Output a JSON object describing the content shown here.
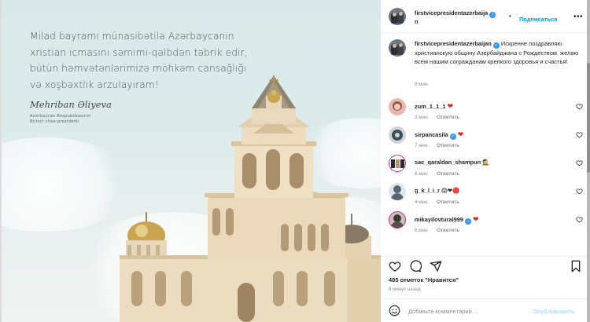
{
  "post_image": {
    "greeting_lines": [
      "Milad bayramı münasibətilə Azərbaycanın",
      "xristian icmasını səmimi-qəlbdən təbrik edir,",
      "bütün həmvətənlərimizə möhkəm cansağlığı",
      "və xoşbəxtlik arzulayıram!"
    ],
    "signer_name": "Mehriban Əliyeva",
    "signer_title_line1": "Azərbaycan Respublikasının",
    "signer_title_line2": "Birinci vitse-prezidenti"
  },
  "header": {
    "username_line1": "firstvicepresidentazerbaija",
    "username_line2": "n",
    "verified_icon": "verified-badge-icon",
    "separator": "•",
    "follow_label": "Подписаться",
    "more_icon": "more-options-icon",
    "more_glyph": "•••"
  },
  "caption": {
    "username": "firstvicepresidentazerbaijan",
    "text": "Искренне поздравляю христианскую общину Азербайджана с Рождеством. желаю всем нашим согражданам крепкого здоровья и счастья!",
    "time": "8 мин."
  },
  "comments": [
    {
      "username": "zum_1_1_1",
      "emoji": "❤",
      "time": "3 мин.",
      "reply_label": "Ответить",
      "verified": false
    },
    {
      "username": "sirpancasila",
      "emoji": "❤",
      "time": "7 мин.",
      "reply_label": "Ответить",
      "verified": true
    },
    {
      "username": "sac_qaraldan_shampun",
      "emoji": "🕵",
      "time": "6 мин.",
      "reply_label": "Ответить",
      "verified": false
    },
    {
      "username": "g_k_l_i_r",
      "emoji": "😱❤🔴",
      "time": "4 мин.",
      "reply_label": "Ответить",
      "verified": false
    },
    {
      "username": "mikayilovtural999",
      "emoji": "❤",
      "time": "6 мин.",
      "reply_label": "Ответить",
      "verified": true
    }
  ],
  "actions": {
    "like_icon": "heart-icon",
    "comment_icon": "comment-icon",
    "share_icon": "share-icon",
    "save_icon": "bookmark-icon"
  },
  "likes_text": "485 отметок \"Нравится\"",
  "time_ago": "8 минут назад",
  "composer": {
    "emoji_icon": "smile-icon",
    "placeholder": "Добавьте комментарий...",
    "post_label": "Опубликовать"
  },
  "colors": {
    "accent_blue": "#0095f6",
    "verified_blue": "#3897f0",
    "muted_text": "#8e8e8e",
    "heart_red": "#ed1c24",
    "post_disabled": "#b2dffc"
  }
}
